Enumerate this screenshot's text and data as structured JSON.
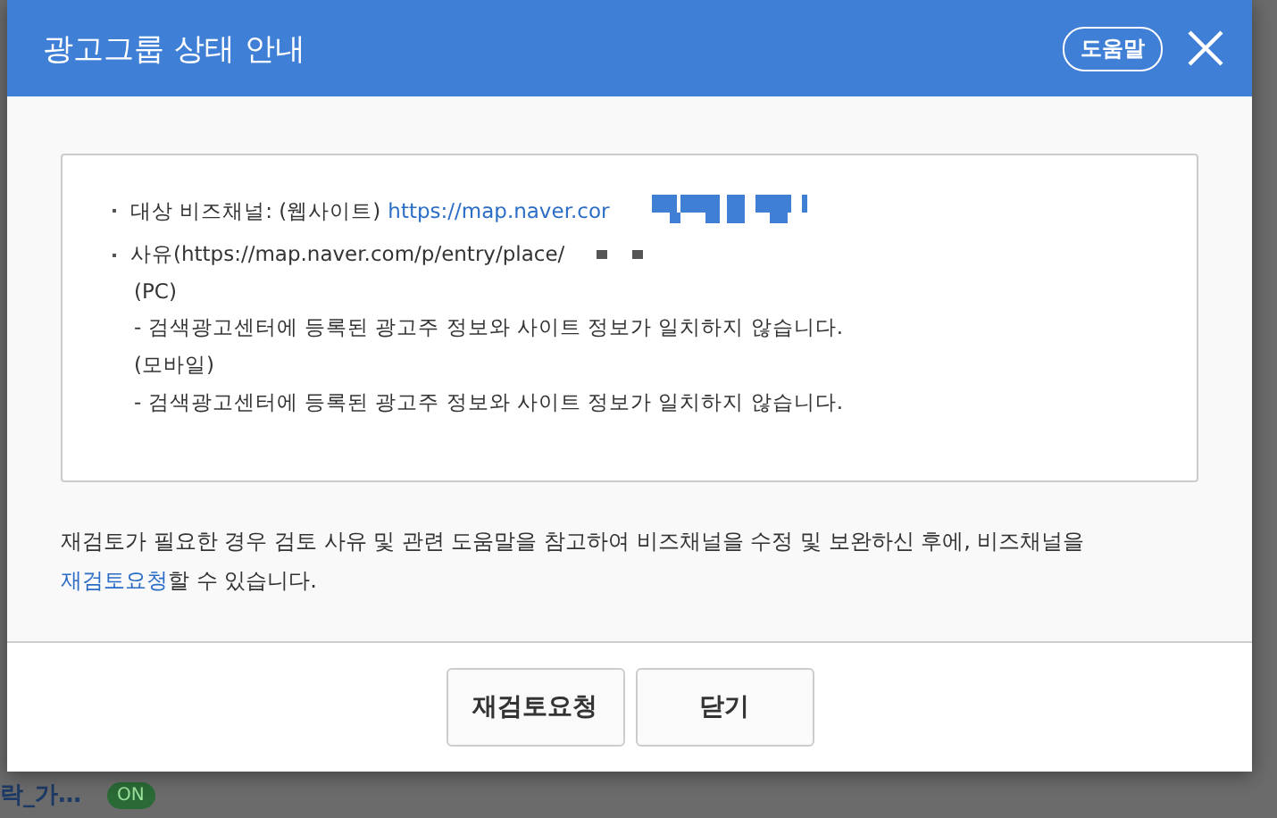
{
  "background": {
    "item_label": "락_가…",
    "status_badge": "ON"
  },
  "dialog": {
    "title": "광고그룹 상태 안내",
    "help_button": "도움말",
    "info": {
      "channel_label": "대상 비즈채널: (웹사이트)",
      "channel_link": "https://map.naver.cor",
      "reason_label": "사유(https://map.naver.com/p/entry/place/",
      "sections": [
        {
          "heading": "(PC)",
          "detail": "- 검색광고센터에 등록된 광고주 정보와 사이트 정보가 일치하지 않습니다."
        },
        {
          "heading": "(모바일)",
          "detail": "- 검색광고센터에 등록된 광고주 정보와 사이트 정보가 일치하지 않습니다."
        }
      ]
    },
    "notice": "재검토가 필요한 경우 검토 사유 및 관련 도움말을 참고하여 비즈채널을 수정 및 보완하신 후에, 비즈채널을 ",
    "notice_link": "재검토요청",
    "notice_end": "할 수 있습니다.",
    "buttons": [
      "재검토요청",
      "닫기"
    ]
  }
}
